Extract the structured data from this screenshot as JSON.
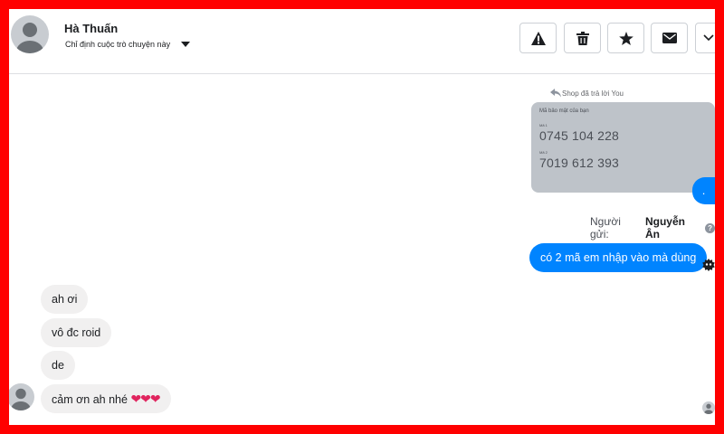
{
  "header": {
    "contact_name": "Hà Thuấn",
    "assign_label": "Chỉ định cuộc trò chuyện này",
    "actions": [
      {
        "name": "report",
        "icon": "warning-icon"
      },
      {
        "name": "delete",
        "icon": "trash-icon"
      },
      {
        "name": "star",
        "icon": "star-icon"
      },
      {
        "name": "mark-unread",
        "icon": "envelope-icon"
      },
      {
        "name": "more",
        "icon": "chevron-down-icon"
      }
    ]
  },
  "messages": {
    "reply_label": "Shop đã trả lời You",
    "shared_card": {
      "title": "Mã bảo mật của bạn",
      "label_1": "Mã 1",
      "code_1": "0745 104 228",
      "label_2": "Mã 2",
      "code_2": "7019 612 393"
    },
    "dot_message": ".",
    "sender_prefix": "Người gửi:",
    "sender_name": "Nguyễn Ân",
    "help_glyph": "?",
    "outgoing_text": "có 2 mã em nhập vào mà dùng",
    "incoming": [
      {
        "text": "ah ơi"
      },
      {
        "text": "vô đc roid"
      },
      {
        "text": "de"
      },
      {
        "text": "cảm ơn ah nhé",
        "hearts": "❤❤❤"
      }
    ]
  },
  "colors": {
    "outgoing_bubble": "#0084ff",
    "incoming_bubble": "#f1f0f0",
    "shared_card": "#bec3c9",
    "frame": "#ff0000"
  }
}
